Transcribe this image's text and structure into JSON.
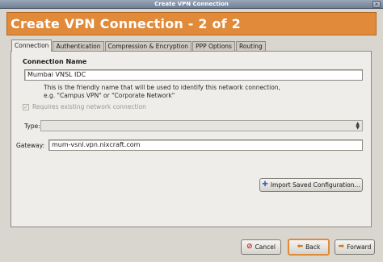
{
  "window": {
    "title": "Create VPN Connection"
  },
  "banner": {
    "heading": "Create VPN Connection - 2 of 2"
  },
  "tabs": [
    {
      "label": "Connection",
      "active": true
    },
    {
      "label": "Authentication",
      "active": false
    },
    {
      "label": "Compression & Encryption",
      "active": false
    },
    {
      "label": "PPP Options",
      "active": false
    },
    {
      "label": "Routing",
      "active": false
    }
  ],
  "connection": {
    "section_title": "Connection Name",
    "name_value": "Mumbai VNSL IDC",
    "help_line1": "This is the friendly name that will be used to identify this network connection,",
    "help_line2": "e.g. \"Campus VPN\" or \"Corporate Network\"",
    "requires_label": "Requires existing network connection",
    "requires_checked": true,
    "requires_enabled": false,
    "type_label": "Type:",
    "type_value": "",
    "gateway_label": "Gateway:",
    "gateway_value": "mum-vsnl.vpn.nixcraft.com",
    "import_button": "Import Saved Configuration..."
  },
  "footer": {
    "cancel": "Cancel",
    "back": "Back",
    "forward": "Forward"
  },
  "colors": {
    "banner": "#e08a3a",
    "dialog_bg": "#d9d6cf",
    "panel_bg": "#efedea",
    "titlebar": "#7f8da2"
  },
  "icons": [
    "close-icon",
    "plus-icon",
    "cancel-icon",
    "back-arrow-icon",
    "forward-arrow-icon",
    "combo-arrows-icon"
  ]
}
